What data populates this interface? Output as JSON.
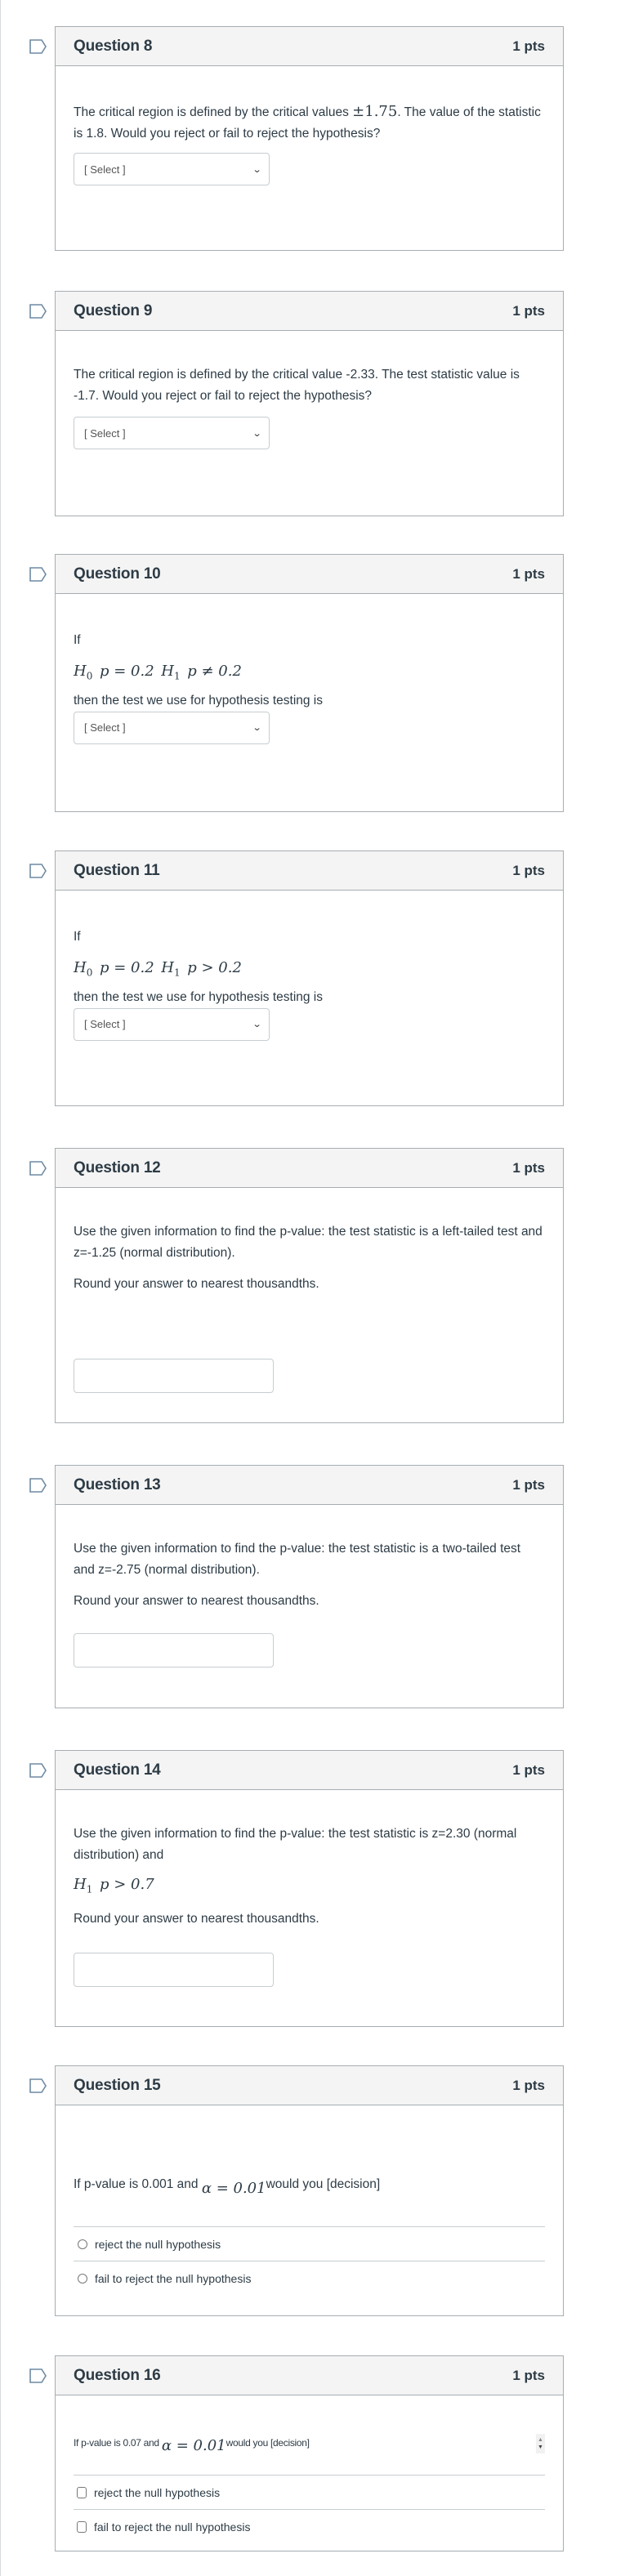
{
  "questions": [
    {
      "title": "Question 8",
      "points": "1 pts",
      "text_before": "The critical region is defined by the critical values ",
      "math": "±1.75",
      "text_after": ". The value of the statistic is 1.8. Would you reject or fail to reject the hypothesis?",
      "select": {
        "value": "[ Select ]"
      }
    },
    {
      "title": "Question 9",
      "points": "1 pts",
      "text": "The critical region is defined by the critical value -2.33. The test statistic value is -1.7. Would you reject or fail to reject the hypothesis?",
      "select": {
        "value": "[ Select ]"
      }
    },
    {
      "title": "Question 10",
      "points": "1 pts",
      "intro": "If",
      "math": {
        "h0": "H",
        "h0_sub": "0",
        "h0_expr": "p = 0.2",
        "h1": "H",
        "h1_sub": "1",
        "h1_expr": "p ≠ 0.2"
      },
      "text": "then the test we use for hypothesis testing is",
      "select": {
        "value": "[ Select ]"
      }
    },
    {
      "title": "Question 11",
      "points": "1 pts",
      "intro": "If",
      "math": {
        "h0": "H",
        "h0_sub": "0",
        "h0_expr": "p = 0.2",
        "h1": "H",
        "h1_sub": "1",
        "h1_expr": "p > 0.2"
      },
      "text": "then the test we use for hypothesis testing is",
      "select": {
        "value": "[ Select ]"
      }
    },
    {
      "title": "Question 12",
      "points": "1 pts",
      "text": "Use the given information to find the p-value: the test statistic is a left-tailed test and z=-1.25 (normal distribution).",
      "note": "Round your answer to nearest thousandths.",
      "input": {
        "value": "",
        "placeholder": ""
      }
    },
    {
      "title": "Question 13",
      "points": "1 pts",
      "text": "Use the given information to find the p-value: the test statistic is a two-tailed test and z=-2.75 (normal distribution).",
      "note": "Round your answer to nearest thousandths.",
      "input": {
        "value": "",
        "placeholder": ""
      }
    },
    {
      "title": "Question 14",
      "points": "1 pts",
      "text": "Use the given information to find the p-value: the test statistic is z=2.30 (normal distribution) and",
      "math": {
        "h1": "H",
        "h1_sub": "1",
        "h1_expr": "p > 0.7"
      },
      "note": "Round your answer to nearest thousandths.",
      "input": {
        "value": "",
        "placeholder": ""
      }
    },
    {
      "title": "Question 15",
      "points": "1 pts",
      "text_before": "If p-value is 0.001 and ",
      "math": "α = 0.01",
      "text_after": "would you [decision]",
      "answers": [
        "reject the null hypothesis",
        "fail to reject the null hypothesis"
      ]
    },
    {
      "title": "Question 16",
      "points": "1 pts",
      "text_before": "If p-value is 0.07 and ",
      "math": "α = 0.01",
      "text_after": "would you [decision]",
      "answers": [
        "reject the null hypothesis",
        "fail to reject the null hypothesis"
      ]
    }
  ],
  "icons": {
    "flag": "flag-outline-icon",
    "spinner_up": "▲",
    "spinner_down": "▼",
    "chevron": "⌄"
  },
  "colors": {
    "header_bg": "#f4f4f4",
    "border": "#a6adb2",
    "flag": "#6e8aa3",
    "text": "#2d3b45"
  }
}
